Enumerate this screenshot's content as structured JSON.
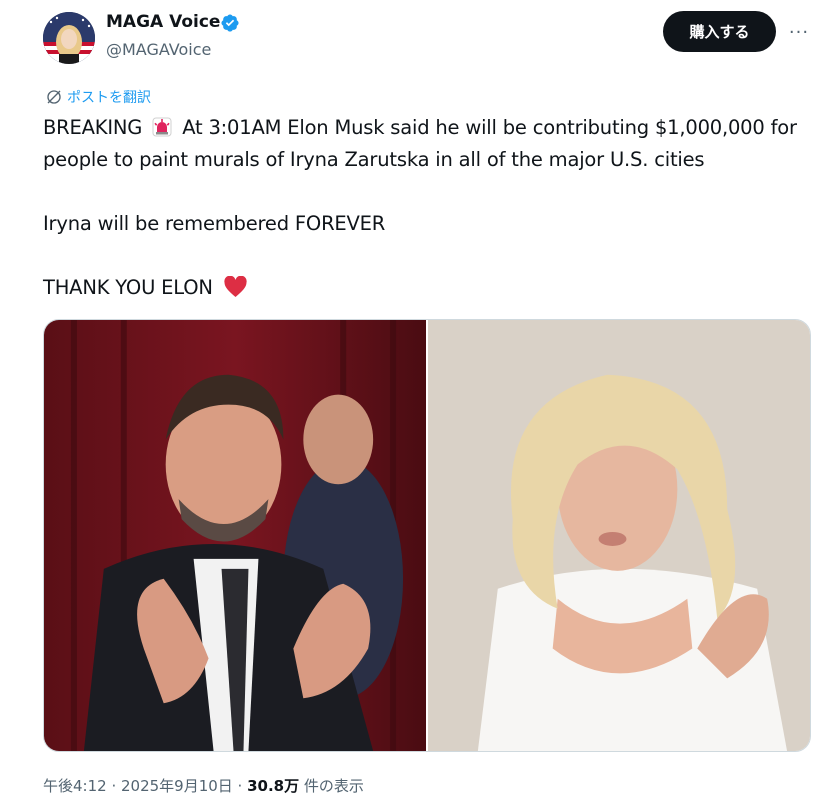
{
  "author": {
    "display_name": "MAGA Voice",
    "handle": "@MAGAVoice",
    "verified_icon": "verified-badge-icon",
    "verified_color": "#1d9bf0"
  },
  "actions": {
    "subscribe_label": "購入する",
    "more_label": "···"
  },
  "translate_label": "ポストを翻訳",
  "tweet": {
    "line1_before": "BREAKING",
    "line1_after": "At 3:01AM Elon Musk said he will be contributing $1,000,000 for people to paint murals of Iryna Zarutska in all of the major U.S. cities",
    "line2": "Iryna will be remembered FOREVER",
    "line3": "THANK YOU ELON",
    "emoji": {
      "siren": "rotating-light-emoji",
      "heart": "red-heart-emoji"
    }
  },
  "media": {
    "photos": [
      {
        "description_icon": "photo-man-heart-hands"
      },
      {
        "description_icon": "photo-woman-blonde"
      }
    ]
  },
  "meta": {
    "time": "午後4:12 · 2025年9月10日 · ",
    "views": "30.8万",
    "views_suffix": " 件の表示"
  },
  "colors": {
    "accent": "#1d9bf0",
    "text": "#0f1419",
    "secondary": "#536471",
    "button_bg": "#0f1419"
  }
}
